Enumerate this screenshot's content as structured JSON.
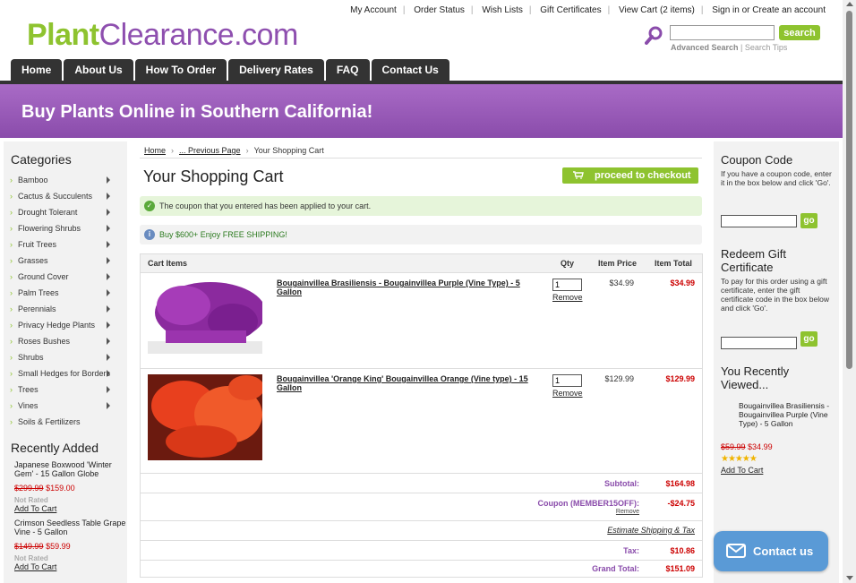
{
  "brand": {
    "part1": "Plant",
    "part2": "Clearance.com"
  },
  "toplinks": [
    "My Account",
    "Order Status",
    "Wish Lists",
    "Gift Certificates",
    "View Cart (2 items)",
    "Sign in or Create an account"
  ],
  "search": {
    "placeholder": "",
    "button": "search",
    "advanced": "Advanced Search",
    "tips": "Search Tips"
  },
  "nav": [
    "Home",
    "About Us",
    "How To Order",
    "Delivery Rates",
    "FAQ",
    "Contact Us"
  ],
  "banner": "Buy Plants Online in Southern California!",
  "sidebar": {
    "categories_title": "Categories",
    "categories": [
      "Bamboo",
      "Cactus & Succulents",
      "Drought Tolerant",
      "Flowering Shrubs",
      "Fruit Trees",
      "Grasses",
      "Ground Cover",
      "Palm Trees",
      "Perennials",
      "Privacy Hedge Plants",
      "Roses Bushes",
      "Shrubs",
      "Small Hedges for Borders",
      "Trees",
      "Vines",
      "Soils & Fertilizers"
    ],
    "recent_title": "Recently Added",
    "recent": [
      {
        "name": "Japanese Boxwood 'Winter Gem' - 15 Gallon Globe",
        "old": "$299.99",
        "new": "$159.00",
        "rating": "Not Rated",
        "add": "Add To Cart"
      },
      {
        "name": "Crimson Seedless Table Grape Vine - 5 Gallon",
        "old": "$149.99",
        "new": "$59.99",
        "rating": "Not Rated",
        "add": "Add To Cart"
      }
    ]
  },
  "breadcrumb": {
    "home": "Home",
    "prev": "... Previous Page",
    "current": "Your Shopping Cart"
  },
  "page_title": "Your Shopping Cart",
  "checkout_label": "proceed to checkout",
  "messages": {
    "coupon": "The coupon that you entered has been applied to your cart.",
    "shipping": "Buy $600+ Enjoy FREE SHIPPING!"
  },
  "cart": {
    "headers": {
      "items": "Cart Items",
      "qty": "Qty",
      "price": "Item Price",
      "total": "Item Total"
    },
    "items": [
      {
        "name": "Bougainvillea Brasiliensis - Bougainvillea Purple (Vine Type) - 5 Gallon",
        "qty": "1",
        "remove": "Remove",
        "price": "$34.99",
        "total": "$34.99",
        "color": "#8b2a9e"
      },
      {
        "name": "Bougainvillea 'Orange King' Bougainvillea Orange (Vine type) - 15 Gallon",
        "qty": "1",
        "remove": "Remove",
        "price": "$129.99",
        "total": "$129.99",
        "color": "#e8401e"
      }
    ],
    "subtotal_label": "Subtotal:",
    "subtotal": "$164.98",
    "coupon_label": "Coupon (MEMBER15OFF):",
    "coupon_value": "-$24.75",
    "coupon_remove": "Remove",
    "estimate": "Estimate Shipping & Tax",
    "tax_label": "Tax:",
    "tax": "$10.86",
    "grand_label": "Grand Total:",
    "grand": "$151.09"
  },
  "right": {
    "coupon_title": "Coupon Code",
    "coupon_text": "If you have a coupon code, enter it in the box below and click 'Go'.",
    "go": "go",
    "gift_title": "Redeem Gift Certificate",
    "gift_text": "To pay for this order using a gift certificate, enter the gift certificate code in the box below and click 'Go'.",
    "viewed_title": "You Recently Viewed...",
    "viewed": {
      "name": "Bougainvillea Brasiliensis - Bougainvillea Purple (Vine Type) - 5 Gallon",
      "old": "$59.99",
      "new": "$34.99",
      "add": "Add To Cart"
    }
  },
  "contact": "Contact us",
  "colors": {
    "green": "#8ec32f",
    "purple": "#8a4cab",
    "red": "#cc0000"
  }
}
